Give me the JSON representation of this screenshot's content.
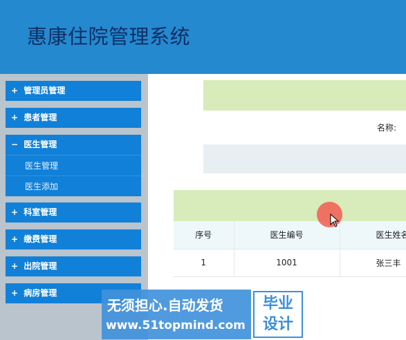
{
  "header": {
    "title": "惠康住院管理系统"
  },
  "sidebar": {
    "groups": [
      {
        "sign": "+",
        "label": "管理员管理"
      },
      {
        "sign": "+",
        "label": "患者管理"
      },
      {
        "sign": "−",
        "label": "医生管理",
        "items": [
          "医生管理",
          "医生添加"
        ]
      },
      {
        "sign": "+",
        "label": "科室管理"
      },
      {
        "sign": "+",
        "label": "缴费管理"
      },
      {
        "sign": "+",
        "label": "出院管理"
      },
      {
        "sign": "+",
        "label": "病房管理"
      }
    ]
  },
  "search": {
    "name_label": "名称:"
  },
  "table": {
    "headers": [
      "序号",
      "医生编号",
      "医生姓名"
    ],
    "rows": [
      [
        "1",
        "1001",
        "张三丰"
      ]
    ]
  },
  "watermark": {
    "line1": "无须担心.自动发货",
    "line2": "www.51topmind.com",
    "badge_line1": "毕业",
    "badge_line2": "设计"
  },
  "colors": {
    "header_bg": "#2589cf",
    "menu_bg": "#1180d8",
    "sidebar_bg": "#b9c4cd",
    "panel_band": "#d8ebba"
  }
}
